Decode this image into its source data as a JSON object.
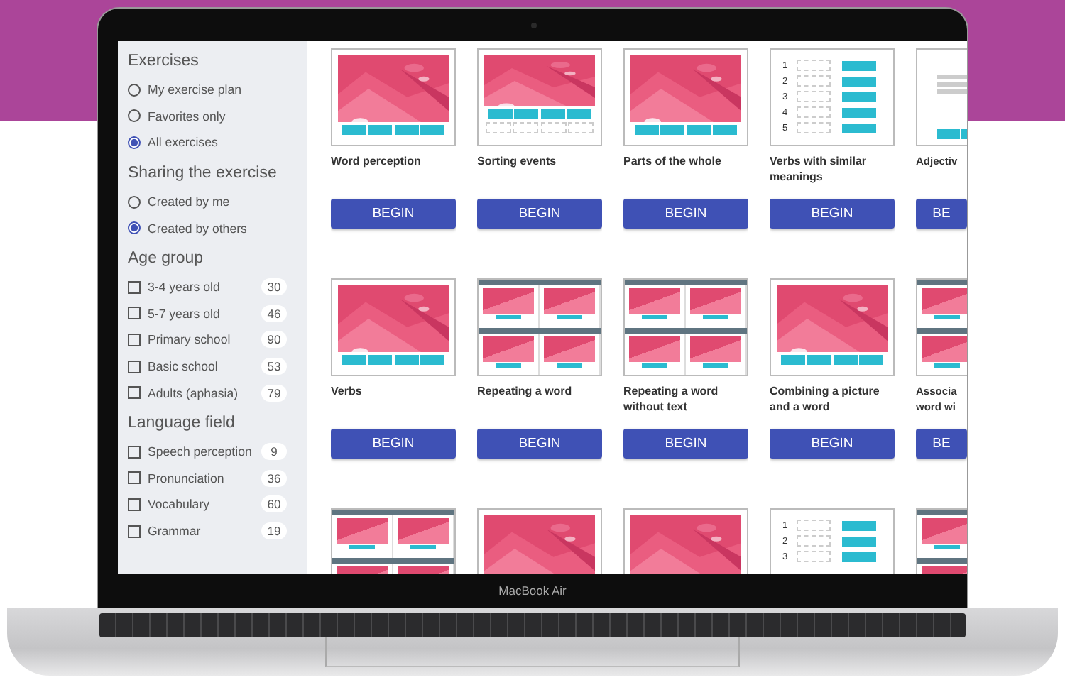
{
  "sidebar": {
    "sections": [
      {
        "title": "Exercises",
        "options": [
          {
            "kind": "radio",
            "label": "My exercise plan",
            "selected": false
          },
          {
            "kind": "radio",
            "label": "Favorites only",
            "selected": false
          },
          {
            "kind": "radio",
            "label": "All exercises",
            "selected": true
          }
        ]
      },
      {
        "title": "Sharing the exercise",
        "options": [
          {
            "kind": "radio",
            "label": "Created by me",
            "selected": false
          },
          {
            "kind": "radio",
            "label": "Created by others",
            "selected": true
          }
        ]
      },
      {
        "title": "Age group",
        "options": [
          {
            "kind": "checkbox",
            "label": "3-4 years old",
            "checked": false,
            "count": "30"
          },
          {
            "kind": "checkbox",
            "label": "5-7 years old",
            "checked": false,
            "count": "46"
          },
          {
            "kind": "checkbox",
            "label": "Primary school",
            "checked": false,
            "count": "90"
          },
          {
            "kind": "checkbox",
            "label": "Basic school",
            "checked": false,
            "count": "53"
          },
          {
            "kind": "checkbox",
            "label": "Adults (aphasia)",
            "checked": false,
            "count": "79"
          }
        ]
      },
      {
        "title": "Language field",
        "options": [
          {
            "kind": "checkbox",
            "label": "Speech perception",
            "checked": false,
            "count": "9"
          },
          {
            "kind": "checkbox",
            "label": "Pronunciation",
            "checked": false,
            "count": "36"
          },
          {
            "kind": "checkbox",
            "label": "Vocabulary",
            "checked": false,
            "count": "60"
          },
          {
            "kind": "checkbox",
            "label": "Grammar",
            "checked": false,
            "count": "19"
          }
        ]
      }
    ]
  },
  "cards": [
    {
      "kind": "scene",
      "title": "Word perception",
      "button": "BEGIN"
    },
    {
      "kind": "sort",
      "title": "Sorting events",
      "button": "BEGIN"
    },
    {
      "kind": "scene",
      "title": "Parts of the whole",
      "button": "BEGIN"
    },
    {
      "kind": "list",
      "numbers": [
        "1",
        "2",
        "3",
        "4",
        "5"
      ],
      "title": "Verbs with similar meanings",
      "button": "BEGIN"
    },
    {
      "kind": "lines",
      "title": "Adjectiv",
      "button": "BE"
    },
    {
      "kind": "scene",
      "title": "Verbs",
      "button": "BEGIN"
    },
    {
      "kind": "grid",
      "title": "Repeating a word",
      "button": "BEGIN"
    },
    {
      "kind": "grid",
      "title": "Repeating a word without text",
      "button": "BEGIN"
    },
    {
      "kind": "scene",
      "title": "Combining a picture and a word",
      "button": "BEGIN"
    },
    {
      "kind": "grid",
      "title": "Associa word wi",
      "button": "BE"
    },
    {
      "kind": "grid"
    },
    {
      "kind": "scene"
    },
    {
      "kind": "scene"
    },
    {
      "kind": "list",
      "numbers": [
        "1",
        "2",
        "3"
      ]
    },
    {
      "kind": "grid"
    }
  ],
  "device_label": "MacBook Air"
}
